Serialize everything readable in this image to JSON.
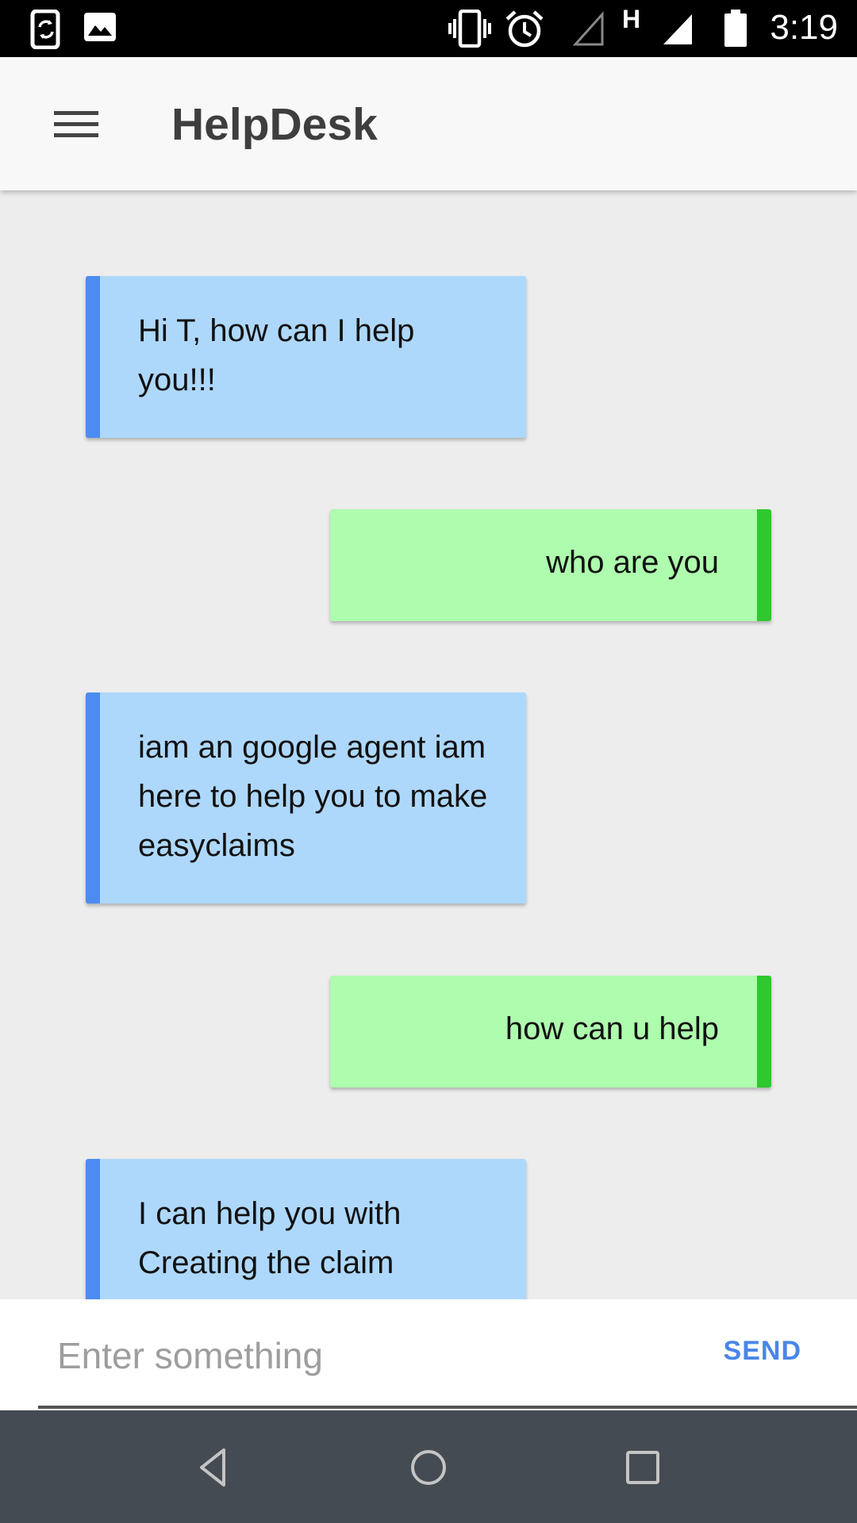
{
  "status_bar": {
    "time": "3:19",
    "icons": [
      "screen-rotation-icon",
      "image-icon",
      "vibrate-icon",
      "alarm-icon",
      "signal-empty-icon",
      "network-h-icon",
      "signal-full-icon",
      "battery-icon"
    ],
    "network_type": "H"
  },
  "app_bar": {
    "title": "HelpDesk",
    "menu_icon": "hamburger-menu-icon"
  },
  "messages": [
    {
      "sender": "bot",
      "text": "Hi T, how can I help you!!!"
    },
    {
      "sender": "user",
      "text": "who are you"
    },
    {
      "sender": "bot",
      "text": "iam an google agent iam here to help you to make easyclaims"
    },
    {
      "sender": "user",
      "text": "how can u help"
    },
    {
      "sender": "bot",
      "text": "I can help you with Creating the claim"
    }
  ],
  "input": {
    "placeholder": "Enter something",
    "value": "",
    "send_label": "SEND"
  },
  "nav_bar": {
    "buttons": [
      "back-icon",
      "home-icon",
      "recents-icon"
    ]
  },
  "colors": {
    "bot_bubble": "#aed8fb",
    "bot_accent": "#4c8cf2",
    "user_bubble": "#aefcae",
    "user_accent": "#2fc82f",
    "send": "#4a86e8",
    "nav_bar": "#454b52"
  }
}
